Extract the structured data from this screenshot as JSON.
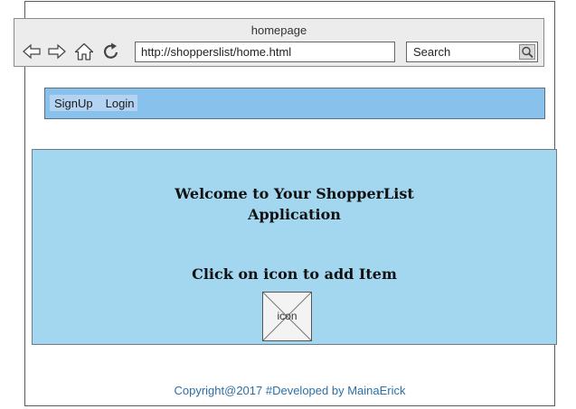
{
  "window": {
    "title": "homepage"
  },
  "browser": {
    "url": "http://shopperslist/home.html",
    "search_value": "Search",
    "icons": [
      "back-arrow-icon",
      "forward-arrow-icon",
      "home-icon",
      "reload-icon",
      "magnifier-icon"
    ]
  },
  "navbar": {
    "links": [
      {
        "label": "SignUp"
      },
      {
        "label": "Login"
      }
    ],
    "color": "#88c1ec"
  },
  "hero": {
    "title_line1": "Welcome to Your ShopperList",
    "title_line2": "Application",
    "subtitle": "Click on icon to add Item",
    "icon_label": "icon",
    "color": "#a3d6ef"
  },
  "footer": {
    "text": "Copyright@2017 #Developed by MainaErick",
    "color": "#2d6fa6"
  }
}
